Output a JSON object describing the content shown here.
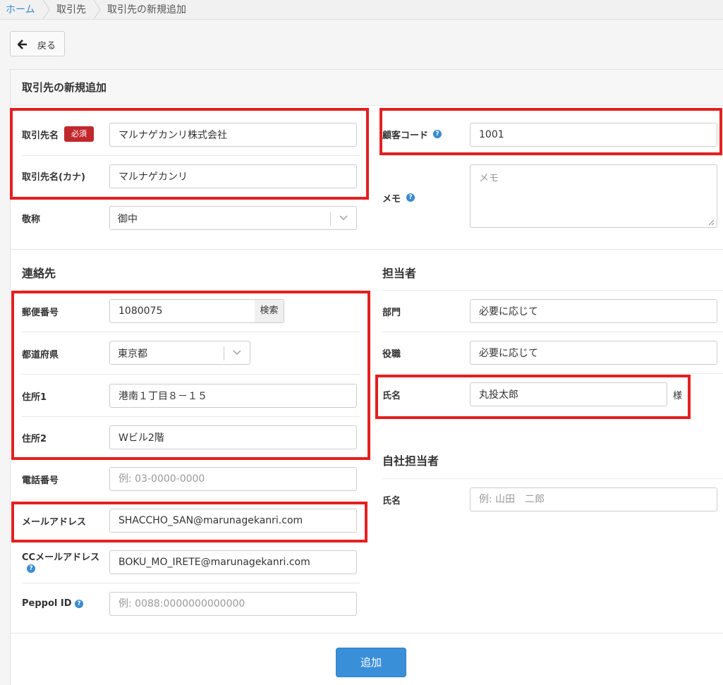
{
  "breadcrumb": {
    "home": "ホーム",
    "partners": "取引先",
    "current": "取引先の新規追加"
  },
  "back_button": {
    "label": "戻る",
    "icon": "arrow-left-icon"
  },
  "page": {
    "title": "取引先の新規追加"
  },
  "basic": {
    "name_label": "取引先名",
    "required_badge": "必須",
    "name_value": "マルナゲカンリ株式会社",
    "kana_label": "取引先名(カナ)",
    "kana_value": "マルナゲカンリ",
    "honorific_label": "敬称",
    "honorific_value": "御中",
    "customer_code_label": "顧客コード",
    "customer_code_value": "1001",
    "memo_label": "メモ",
    "memo_placeholder": "メモ"
  },
  "contact": {
    "section_title": "連絡先",
    "postal_label": "郵便番号",
    "postal_value": "1080075",
    "search_label": "検索",
    "prefecture_label": "都道府県",
    "prefecture_value": "東京都",
    "address1_label": "住所1",
    "address1_value": "港南１丁目８－１５",
    "address2_label": "住所2",
    "address2_value": "Wビル2階",
    "phone_label": "電話番号",
    "phone_placeholder": "例: 03-0000-0000",
    "email_label": "メールアドレス",
    "email_value": "SHACCHO_SAN@marunagekanri.com",
    "cc_email_label": "CCメールアドレス",
    "cc_email_value": "BOKU_MO_IRETE@marunagekanri.com",
    "peppol_label": "Peppol ID",
    "peppol_placeholder": "例: 0088:0000000000000"
  },
  "person": {
    "section_title": "担当者",
    "department_label": "部門",
    "department_value": "必要に応じて",
    "position_label": "役職",
    "position_value": "必要に応じて",
    "name_label": "氏名",
    "name_value": "丸投太郎",
    "suffix": "様"
  },
  "own_person": {
    "section_title": "自社担当者",
    "name_label": "氏名",
    "name_placeholder": "例: 山田　二郎"
  },
  "submit": {
    "label": "追加"
  },
  "colors": {
    "accent": "#3a8fd9",
    "required": "#c0282d",
    "link": "#3a8bd0",
    "highlight": "#e32020"
  }
}
